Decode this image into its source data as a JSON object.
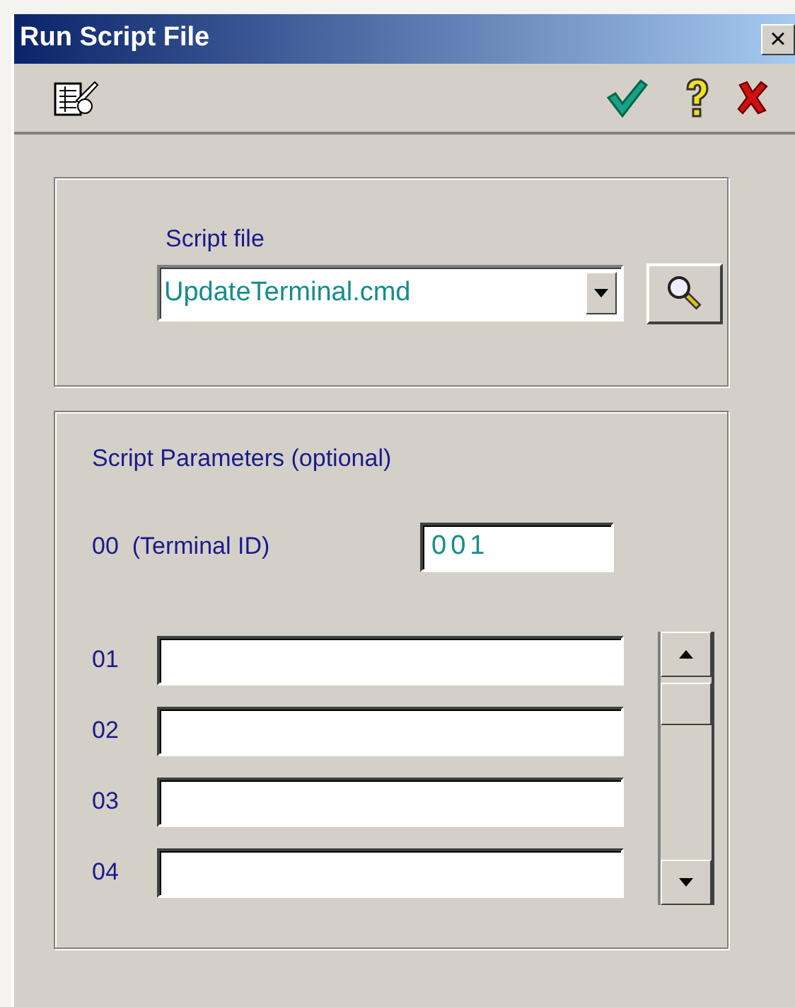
{
  "window": {
    "title": "Run Script File",
    "close": "×"
  },
  "script_file": {
    "label": "Script file",
    "value": "UpdateTerminal.cmd"
  },
  "parameters": {
    "title": "Script Parameters (optional)",
    "terminal": {
      "label": "00  (Terminal ID)",
      "value": "001"
    },
    "rows": [
      {
        "label": "01"
      },
      {
        "label": "02"
      },
      {
        "label": "03"
      },
      {
        "label": "04"
      }
    ]
  }
}
